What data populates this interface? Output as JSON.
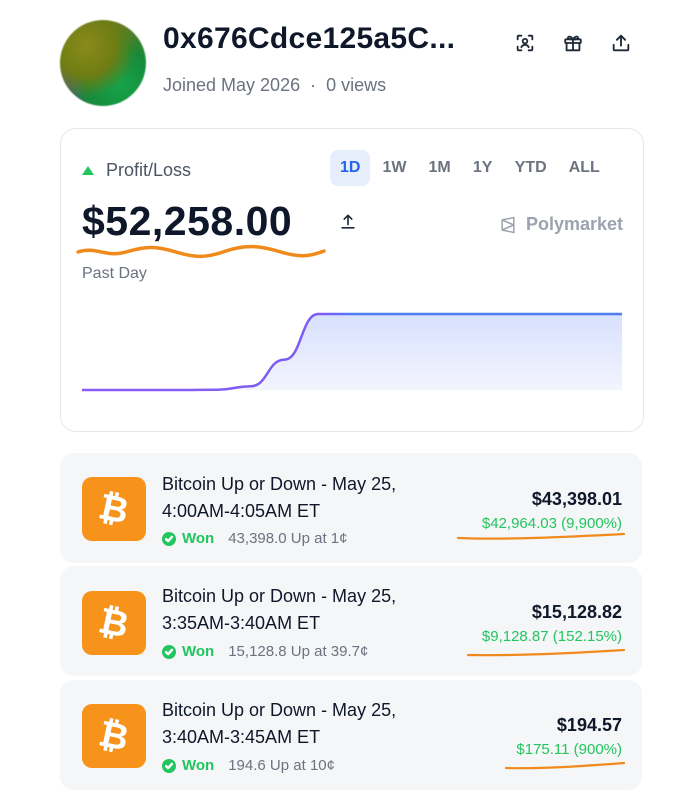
{
  "profile": {
    "address": "0x676Cdce125a5C...",
    "joined": "Joined May 2026",
    "views": "0 views",
    "separator": "·"
  },
  "header_icons": [
    "scan-icon",
    "gift-icon",
    "share-icon"
  ],
  "pnl": {
    "label": "Profit/Loss",
    "amount": "$52,258.00",
    "period": "Past Day",
    "brand": "Polymarket",
    "tabs": [
      "1D",
      "1W",
      "1M",
      "1Y",
      "YTD",
      "ALL"
    ],
    "active_tab": "1D"
  },
  "chart_data": {
    "type": "area",
    "series": [
      {
        "values": [
          0,
          0,
          0,
          0,
          0.3,
          5,
          40,
          100,
          100,
          100,
          100,
          100,
          100,
          100,
          100,
          100,
          100
        ]
      }
    ],
    "y_unit": "percent of total",
    "colors": {
      "line": "#4f7cf0",
      "start_line": "#8b5cf6",
      "fill": "#dfe6fd"
    }
  },
  "positions": [
    {
      "title": "Bitcoin Up or Down - May 25, 4:00AM-4:05AM ET",
      "status": "Won",
      "detail": "43,398.0 Up at 1¢",
      "value": "$43,398.01",
      "gain": "$42,964.03 (9,900%)"
    },
    {
      "title": "Bitcoin Up or Down - May 25, 3:35AM-3:40AM ET",
      "status": "Won",
      "detail": "15,128.8 Up at 39.7¢",
      "value": "$15,128.82",
      "gain": "$9,128.87 (152.15%)"
    },
    {
      "title": "Bitcoin Up or Down - May 25, 3:40AM-3:45AM ET",
      "status": "Won",
      "detail": "194.6 Up at 10¢",
      "value": "$194.57",
      "gain": "$175.11 (900%)"
    }
  ],
  "colors": {
    "accent": "#2563eb",
    "positive": "#22c55e",
    "bitcoin": "#f7931a",
    "annotation": "#f08a1c"
  },
  "btc_symbol": "₿"
}
